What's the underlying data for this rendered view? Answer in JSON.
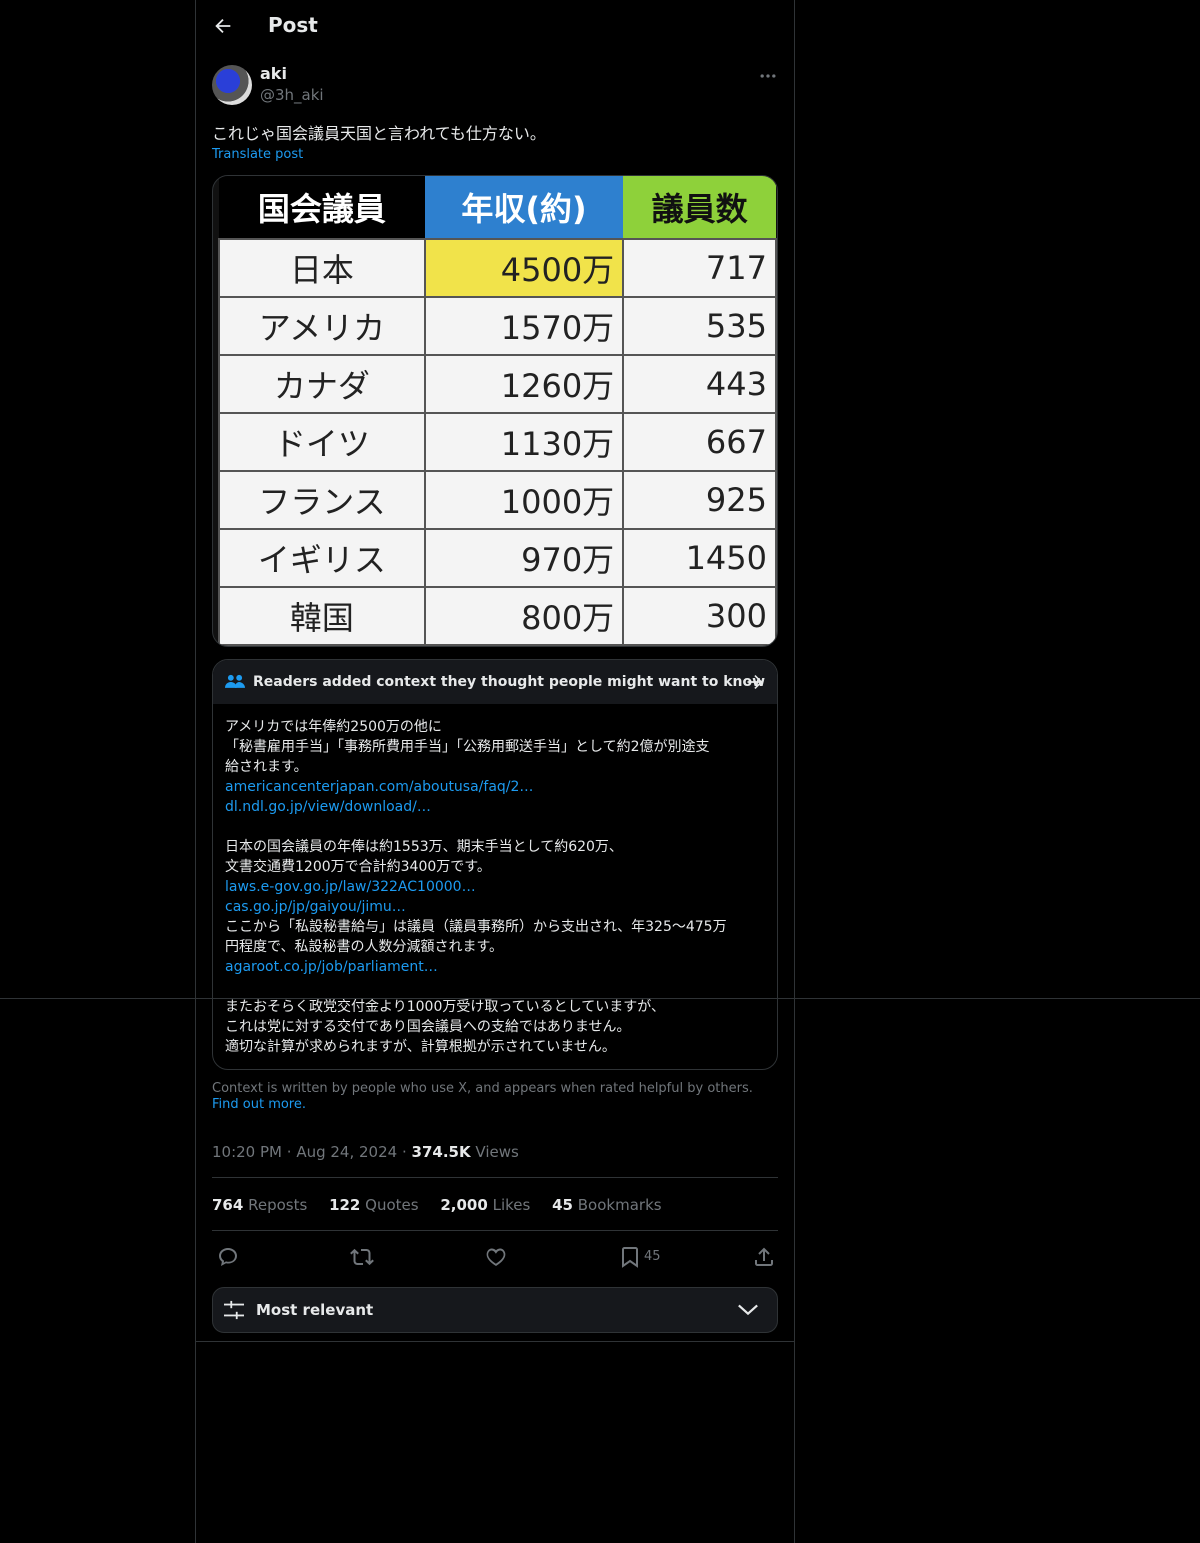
{
  "header": {
    "title": "Post"
  },
  "post": {
    "author_name": "aki",
    "author_handle": "@3h_aki",
    "text": "これじゃ国会議員天国と言われても仕方ない。",
    "translate_label": "Translate post",
    "image_table": {
      "headers": [
        "国会議員",
        "年収(約)",
        "議員数"
      ],
      "rows": [
        [
          "日本",
          "4500万",
          "717"
        ],
        [
          "アメリカ",
          "1570万",
          "535"
        ],
        [
          "カナダ",
          "1260万",
          "443"
        ],
        [
          "ドイツ",
          "1130万",
          "667"
        ],
        [
          "フランス",
          "1000万",
          "925"
        ],
        [
          "イギリス",
          "970万",
          "1450"
        ],
        [
          "韓国",
          "800万",
          "300"
        ]
      ],
      "colors": {
        "header1": "#000000",
        "header2": "#2e80cf",
        "header3": "#8ed13a",
        "highlight": "#f1e34a"
      }
    }
  },
  "community_note": {
    "title": "Readers added context they thought people might want to know",
    "line1": "アメリカでは年俸約2500万の他に",
    "line2": "「秘書雇用手当」「事務所費用手当」「公務用郵送手当」として約2億が別途支",
    "line3": "給されます。",
    "link1": "americancenterjapan.com/aboutusa/faq/2…",
    "link2": "dl.ndl.go.jp/view/download/…",
    "line4": "日本の国会議員の年俸は約1553万、期末手当として約620万、",
    "line5": "文書交通費1200万で合計約3400万です。",
    "link3": "laws.e-gov.go.jp/law/322AC10000…",
    "link4": "cas.go.jp/jp/gaiyou/jimu…",
    "line6": "ここから「私設秘書給与」は議員（議員事務所）から支出され、年325〜475万",
    "line7": "円程度で、私設秘書の人数分減額されます。",
    "link5": "agaroot.co.jp/job/parliament…",
    "line8": "またおそらく政党交付金より1000万受け取っているとしていますが、",
    "line9": "これは党に対する交付であり国会議員への支給ではありません。",
    "line10": "適切な計算が求められますが、計算根拠が示されていません。"
  },
  "context_footer": {
    "text": "Context is written by people who use X, and appears when rated helpful by others.",
    "link": "Find out more."
  },
  "meta": {
    "time": "10:20 PM",
    "dot": "·",
    "date": "Aug 24, 2024",
    "views_count": "374.5K",
    "views_label": "Views"
  },
  "stats": {
    "reposts_count": "764",
    "reposts_label": "Reposts",
    "quotes_count": "122",
    "quotes_label": "Quotes",
    "likes_count": "2,000",
    "likes_label": "Likes",
    "bookmarks_count": "45",
    "bookmarks_label": "Bookmarks"
  },
  "actions": {
    "bookmark_count": "45"
  },
  "sort": {
    "label": "Most relevant"
  }
}
